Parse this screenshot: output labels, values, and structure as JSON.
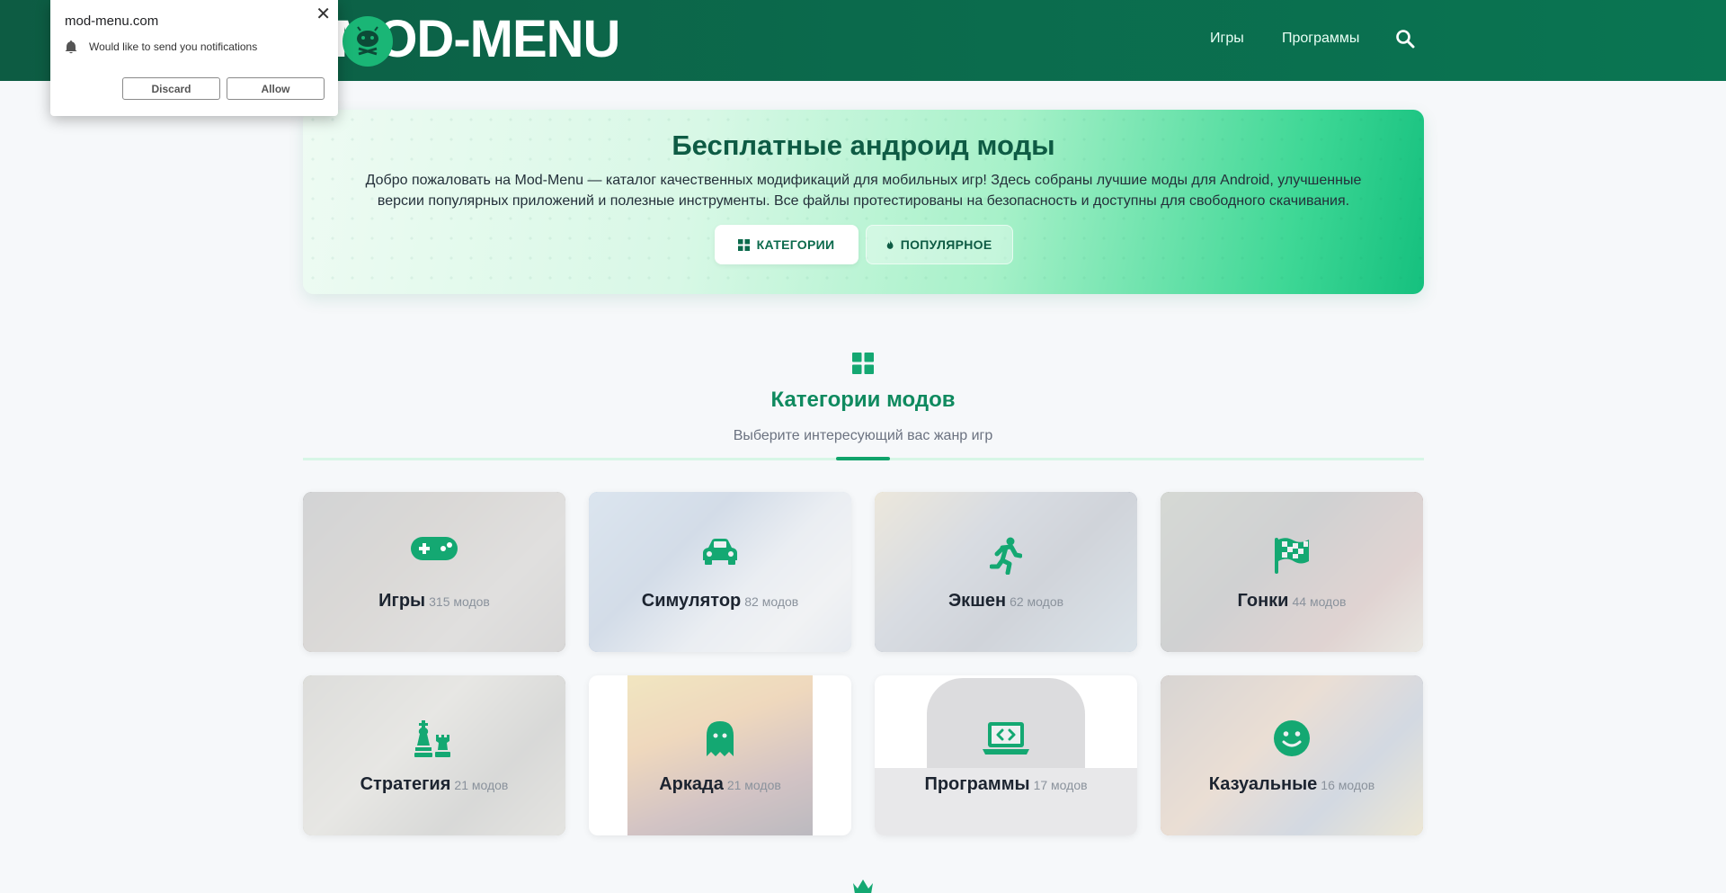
{
  "header": {
    "logo_text": "MOD-MENU",
    "nav": [
      "Игры",
      "Программы"
    ]
  },
  "hero": {
    "title": "Бесплатные андроид моды",
    "description": "Добро пожаловать на Mod-Menu — каталог качественных модификаций для мобильных игр! Здесь собраны лучшие моды для Android, улучшенные версии популярных приложений и полезные инструменты. Все файлы протестированы на безопасность и доступны для свободного скачивания.",
    "btn_categories": "КАТЕГОРИИ",
    "btn_popular": "ПОПУЛЯРНОЕ"
  },
  "section": {
    "title": "Категории модов",
    "subtitle": "Выберите интересующий вас жанр игр"
  },
  "categories": [
    {
      "name": "Игры",
      "count": "315 модов",
      "icon": "gamepad-icon"
    },
    {
      "name": "Симулятор",
      "count": "82 модов",
      "icon": "car-icon"
    },
    {
      "name": "Экшен",
      "count": "62 модов",
      "icon": "running-icon"
    },
    {
      "name": "Гонки",
      "count": "44 модов",
      "icon": "checkered-flag-icon"
    },
    {
      "name": "Стратегия",
      "count": "21 модов",
      "icon": "chess-icon"
    },
    {
      "name": "Аркада",
      "count": "21 модов",
      "icon": "ghost-icon"
    },
    {
      "name": "Программы",
      "count": "17 модов",
      "icon": "laptop-code-icon"
    },
    {
      "name": "Казуальные",
      "count": "16 модов",
      "icon": "smile-icon"
    }
  ],
  "notification": {
    "domain": "mod-menu.com",
    "message": "Would like to send you notifications",
    "discard": "Discard",
    "allow": "Allow",
    "close": "✕"
  },
  "colors": {
    "header": "#0b6a4c",
    "accent": "#10a36b",
    "icon": "#14a872"
  }
}
